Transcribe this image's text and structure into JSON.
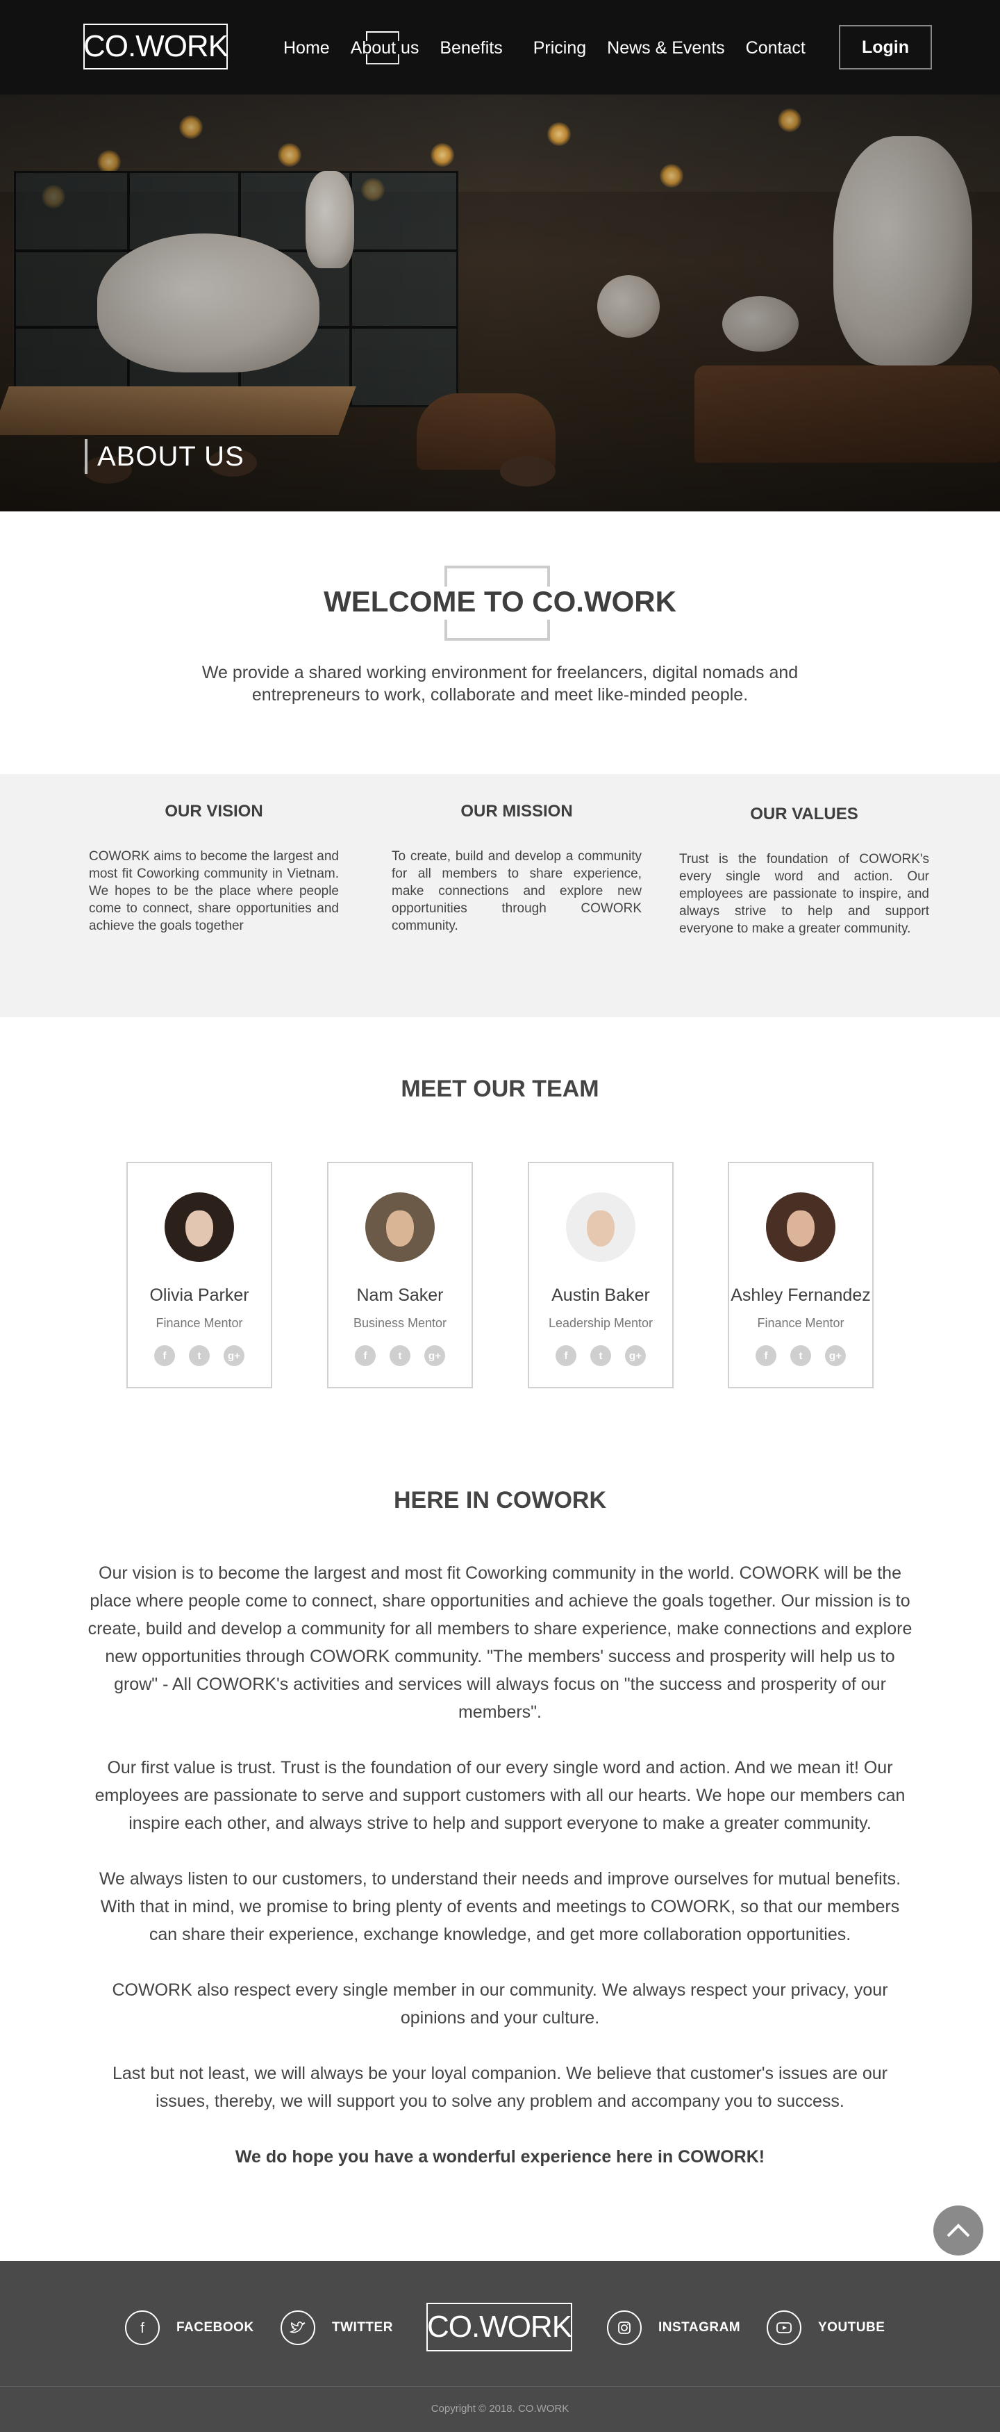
{
  "header": {
    "logo": "CO.WORK",
    "nav": [
      "Home",
      "About us",
      "Benefits",
      "Pricing",
      "News & Events",
      "Contact"
    ],
    "login": "Login"
  },
  "hero": {
    "title": "ABOUT US"
  },
  "welcome": {
    "title": "WELCOME TO CO.WORK",
    "text": "We provide a shared working environment for freelancers, digital nomads and entrepreneurs to work, collaborate and meet like-minded people."
  },
  "vmv": [
    {
      "title": "OUR VISION",
      "text": "COWORK aims to become the largest and most fit Coworking community in Vietnam. We hopes to be the place where people come to connect, share opportunities and achieve the goals together"
    },
    {
      "title": "OUR MISSION",
      "text": "To create, build and develop a community for all members to share experience, make connections and explore new opportunities through COWORK community."
    },
    {
      "title": "OUR VALUES",
      "text": "Trust is the foundation of COWORK's every single word and action. Our employees are passionate to inspire, and always strive to help and support everyone to make a greater community."
    }
  ],
  "team": {
    "title": "MEET OUR TEAM",
    "members": [
      {
        "name": "Olivia Parker",
        "role": "Finance Mentor"
      },
      {
        "name": "Nam Saker",
        "role": "Business Mentor"
      },
      {
        "name": "Austin Baker",
        "role": "Leadership Mentor"
      },
      {
        "name": "Ashley Fernandez",
        "role": "Finance Mentor"
      }
    ]
  },
  "here": {
    "title": "HERE IN COWORK",
    "paragraphs": [
      "Our vision is to become the largest and most fit Coworking community in the world. COWORK will be the place where people come to connect, share opportunities and achieve the goals together. Our mission is to create, build and develop a community for all members to share experience, make connections and explore new opportunities through COWORK community. \"The members' success and prosperity will help us to grow\" - All COWORK's activities and services will always focus on \"the success and prosperity of our members\".",
      "Our first value is trust. Trust is the foundation of our every single word and action. And we mean it! Our employees are passionate to serve and support customers with all our hearts. We hope our members can inspire each other, and always strive to help and support everyone to make a greater community.",
      "We always listen to our customers, to understand their needs and improve ourselves for mutual benefits. With that in mind, we promise to bring plenty of events and meetings to COWORK, so that our members can share their experience, exchange knowledge, and get more collaboration opportunities.",
      "COWORK also respect every single member in our community. We always respect your privacy, your opinions and your culture.",
      "Last but not least, we will always be your loyal companion. We believe that customer's issues are our issues, thereby, we will support you to solve any problem and accompany you to success."
    ],
    "closing": "We do hope you have a wonderful experience here in COWORK!"
  },
  "footer": {
    "facebook": "FACEBOOK",
    "twitter": "TWITTER",
    "logo": "CO.WORK",
    "instagram": "INSTAGRAM",
    "youtube": "YOUTUBE",
    "copyright": "Copyright © 2018. CO.WORK"
  },
  "colors": {
    "header_bg": "#111111",
    "footer_bg": "#4a4a4a",
    "section_bg": "#f2f2f2",
    "text": "#444444",
    "social_icon": "#cfcfcf"
  },
  "icons": {
    "member_socials": [
      "facebook-icon",
      "twitter-icon",
      "google-plus-icon"
    ],
    "scroll_top": "chevron-up-icon"
  }
}
